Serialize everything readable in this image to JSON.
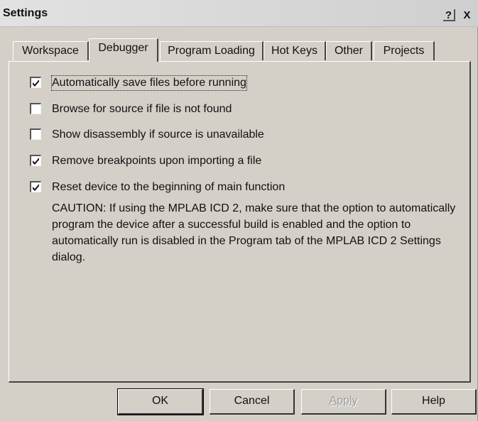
{
  "window": {
    "title": "Settings",
    "help_glyph": "?",
    "close_glyph": "X"
  },
  "tabs": [
    {
      "label": "Workspace",
      "active": false
    },
    {
      "label": "Debugger",
      "active": true
    },
    {
      "label": "Program Loading",
      "active": false
    },
    {
      "label": "Hot Keys",
      "active": false
    },
    {
      "label": "Other",
      "active": false
    },
    {
      "label": "Projects",
      "active": false
    }
  ],
  "options": [
    {
      "label": "Automatically save files before running",
      "checked": true
    },
    {
      "label": "Browse for source if file is not found",
      "checked": false
    },
    {
      "label": "Show disassembly if source is unavailable",
      "checked": false
    },
    {
      "label": "Remove breakpoints upon importing a file",
      "checked": true
    },
    {
      "label": "Reset device to the beginning of main function",
      "checked": true
    }
  ],
  "caution": "CAUTION:  If using the MPLAB ICD 2, make sure that the option to automatically program the device after a successful build is enabled and the option to automatically run is disabled in the Program tab of the MPLAB ICD 2 Settings dialog.",
  "buttons": {
    "ok": "OK",
    "cancel": "Cancel",
    "apply": "Apply",
    "help": "Help"
  },
  "icons": {
    "check": "check-mark",
    "help": "help-icon",
    "close": "close-icon"
  }
}
